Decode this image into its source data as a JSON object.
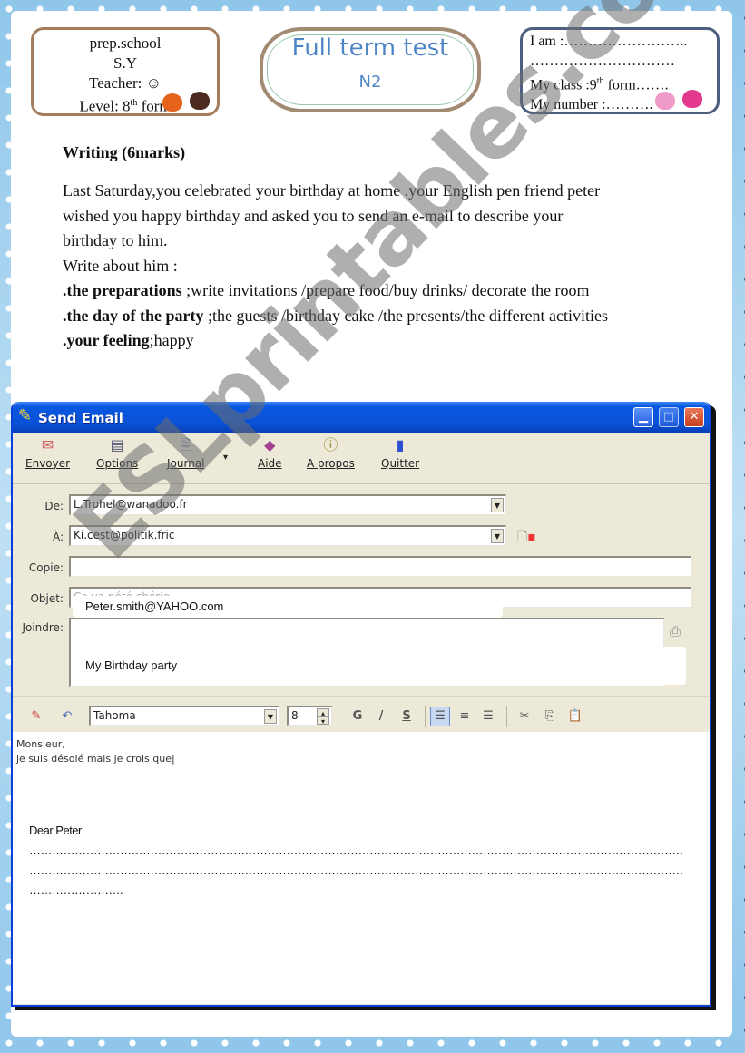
{
  "header": {
    "school_box": {
      "school": "prep.school",
      "year": "S.Y",
      "teacher_label": "Teacher:",
      "teacher_value": "☺",
      "level_label": "Level: 8",
      "level_sup": "th",
      "level_suffix": " form"
    },
    "title_box": {
      "title": "Full term test",
      "subtitle": "N2"
    },
    "student_box": {
      "name_line": "I am :……………………..",
      "name_line2": "…………………………",
      "class_label": "My class :9",
      "class_sup": "th",
      "class_suffix": "  form…….",
      "number_line": "My number :………."
    }
  },
  "writing": {
    "heading": "Writing (6marks)",
    "prompt_lines": [
      "Last Saturday,you celebrated your birthday at home .your English pen friend peter",
      "wished you happy birthday and asked you to send an e-mail to describe your",
      "birthday to him.",
      "Write about him :"
    ],
    "bullets": [
      {
        "bold": ".the preparations",
        "rest": " ;write invitations /prepare food/buy drinks/ decorate the room"
      },
      {
        "bold": ".the day of the party",
        "rest": " ;the guests /birthday cake /the presents/the different activities"
      },
      {
        "bold": ".your feeling",
        "rest": ";happy"
      }
    ]
  },
  "email_window": {
    "title": "Send Email",
    "toolbar": [
      {
        "label": "Envoyer",
        "icon": "send-icon"
      },
      {
        "label": "Options",
        "icon": "options-icon"
      },
      {
        "label": "Journal",
        "icon": "journal-icon"
      },
      {
        "label": "Aide",
        "icon": "help-book-icon"
      },
      {
        "label": "A propos",
        "icon": "about-icon"
      },
      {
        "label": "Quitter",
        "icon": "exit-door-icon"
      }
    ],
    "fields": {
      "from_label": "De:",
      "from_value": "L.Trohel@wanadoo.fr",
      "to_label": "À:",
      "to_value": "Ki.cest@politik.fric",
      "cc_label": "Copie:",
      "cc_value": "",
      "subject_label": "Objet:",
      "subject_value": "Ça va pété chérie",
      "attach_label": "Joindre:",
      "overlay_to": "Peter.smith@YAHOO.com",
      "overlay_subject": "My Birthday  party"
    },
    "format_bar": {
      "font": "Tahoma",
      "size": "8",
      "bold": "G",
      "italic": "/",
      "strike": "S"
    },
    "body": {
      "pre_line1": "Monsieur,",
      "pre_line2": "je suis désolé mais je crois que|",
      "greeting": "Dear Peter",
      "lines": [
        "……………………………………………………………………………………………………………………………………………………………………………………………………………………………………………………",
        "……………………………………………………………………………………………………………………………………………………………………………………………………………………………………………………",
        "……………………."
      ]
    }
  },
  "watermark": "ESLprintables.com"
}
